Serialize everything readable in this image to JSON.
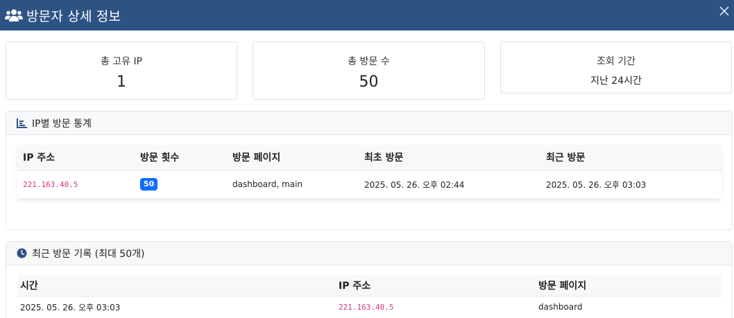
{
  "header": {
    "title": "방문자 상세 정보"
  },
  "stats": [
    {
      "label": "총 고유 IP",
      "value": "1"
    },
    {
      "label": "총 방문 수",
      "value": "50"
    },
    {
      "label": "조회 기간",
      "value": "지난 24시간"
    }
  ],
  "ip_stats": {
    "title": "IP별 방문 통계",
    "columns": [
      "IP 주소",
      "방문 횟수",
      "방문 페이지",
      "최초 방문",
      "최근 방문"
    ],
    "rows": [
      {
        "ip": "221.163.40.5",
        "count": "50",
        "pages": "dashboard, main",
        "first": "2025. 05. 26. 오후 02:44",
        "last": "2025. 05. 26. 오후 03:03"
      }
    ]
  },
  "recent": {
    "title": "최근 방문 기록 (최대 50개)",
    "columns": [
      "시간",
      "IP 주소",
      "방문 페이지"
    ],
    "rows": [
      {
        "time": "2025. 05. 26. 오후 03:03",
        "ip": "221.163.40.5",
        "page": "dashboard"
      }
    ]
  },
  "colors": {
    "header_bg": "#2d5284",
    "badge": "#0d6efd",
    "ip_text": "#d63384"
  },
  "icons": {
    "title": "users-icon",
    "close": "close-icon",
    "ip_stats": "bar-chart-icon",
    "recent": "clock-icon"
  }
}
